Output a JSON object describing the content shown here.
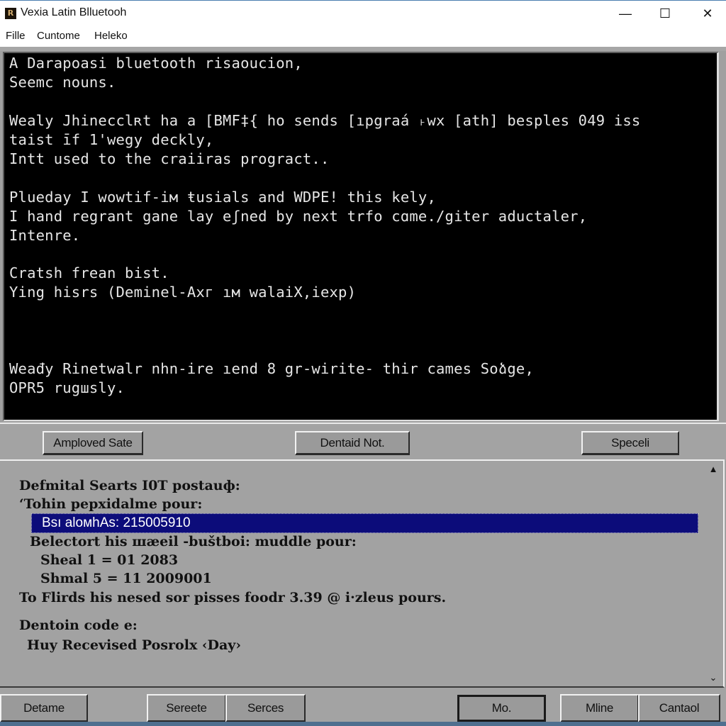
{
  "window": {
    "title": "Vexia Latin Blluetooh",
    "icon": "app-logo-icon",
    "controls": {
      "minimize": "—",
      "maximize": "☐",
      "close": "✕"
    }
  },
  "menu": [
    "Fille",
    "Cuntome",
    "Heleko"
  ],
  "console": {
    "lines": [
      "A Darapoasi bluetooth risaoucion,",
      "Seemc nouns.",
      "",
      "Wealy Jhinecclʀt ha a [BMF‡{ ho sends [ıpgraá ˫wx [ath] besples 049 iss",
      "taist īf 1'wegy deckly,",
      "Intt used to the craiiras progract..",
      "",
      "Plueday I wowtif-iм ŧusials and WDPE! this kely,",
      "I hand regrant gane lay eʃned by next trfo cɑme./giter aductaler,",
      "Intenre.",
      "",
      "Cratsh frean bist.",
      "Ying hisrs (Deminel-Aхг ıм walaiX,iexp)",
      "",
      "",
      "",
      "Weađy Rinetwalr nհո-ire ıend 8 gr-wirite- thir cames Soձge,",
      "OPR5 rugшsly."
    ]
  },
  "mid_buttons": [
    "Amploved Sate",
    "Dentaid Not.",
    "Speceli"
  ],
  "panel": {
    "heading": "Defmital Searts I0T postauф:",
    "subheading": "‘Tohin pepхidalme pour:",
    "selected_item": "Bsı aloмhAs:  215005910",
    "line3": "Belectort his шæeil -buštboi: muddle pour:",
    "line4": "Sheal 1 = 01 2083",
    "line5": "Shmal 5 = 11 2009001",
    "line6": "To Flirds his nesed sor pisses foodr 3.39 @ i·zleus pours.",
    "line7": "Dentoin code e:",
    "line8": "Huy Recevised Posrolx ‹Day›",
    "scroll_up": "▲",
    "scroll_down": "⌄"
  },
  "bottom_buttons": [
    "Detame",
    "Sereete",
    "Serces",
    "Mo.",
    "Mline",
    "Cantaol"
  ]
}
